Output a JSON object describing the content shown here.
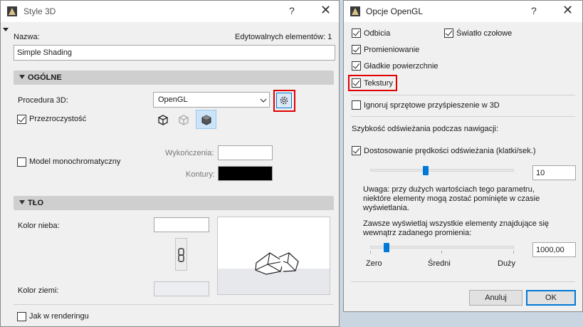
{
  "left_window": {
    "title": "Style 3D",
    "help_label": "?",
    "close_label": "✕",
    "name_label": "Nazwa:",
    "editable_label": "Edytowalnych elementów: 1",
    "name_value": "Simple Shading",
    "section_general": "OGÓLNE",
    "procedure_label": "Procedura 3D:",
    "procedure_value": "OpenGL",
    "transparency_label": "Przezroczystość",
    "transparency_checked": true,
    "monochrome_label": "Model monochromatyczny",
    "monochrome_checked": false,
    "finish_label": "Wykończenia:",
    "contours_label": "Kontury:",
    "contours_color": "#000000",
    "section_background": "TŁO",
    "sky_color_label": "Kolor nieba:",
    "ground_color_label": "Kolor ziemi:",
    "as_rendering_label": "Jak w renderingu",
    "as_rendering_checked": false
  },
  "right_window": {
    "title": "Opcje OpenGL",
    "help_label": "?",
    "close_label": "✕",
    "reflections_label": "Odbicia",
    "reflections_checked": true,
    "headlight_label": "Światło czołowe",
    "headlight_checked": true,
    "radiosity_label": "Promieniowanie",
    "radiosity_checked": true,
    "smooth_label": "Gładkie powierzchnie",
    "smooth_checked": true,
    "textures_label": "Tekstury",
    "textures_checked": true,
    "ignore_hw_label": "Ignoruj sprzętowe przyśpieszenie w 3D",
    "ignore_hw_checked": false,
    "nav_speed_heading": "Szybkość odświeżania podczas nawigacji:",
    "adapt_speed_label": "Dostosowanie prędkości odświeżania (klatki/sek.)",
    "adapt_speed_checked": true,
    "fps_value": "10",
    "fps_slider_fraction": 0.38,
    "note_text": "Uwaga: przy dużych wartościach tego parametru, niektóre elementy mogą zostać pominięte w czasie wyświetlania.",
    "always_show_text": "Zawsze wyświetlaj wszystkie elementy znajdujące się wewnątrz zadanego promienia:",
    "radius_value": "1000,00",
    "radius_slider_fraction": 0.1,
    "scale_min": "Zero",
    "scale_mid": "Średni",
    "scale_max": "Duży",
    "cancel_label": "Anuluj",
    "ok_label": "OK"
  },
  "colors": {
    "accent": "#0078d7",
    "highlight": "#e00000"
  }
}
